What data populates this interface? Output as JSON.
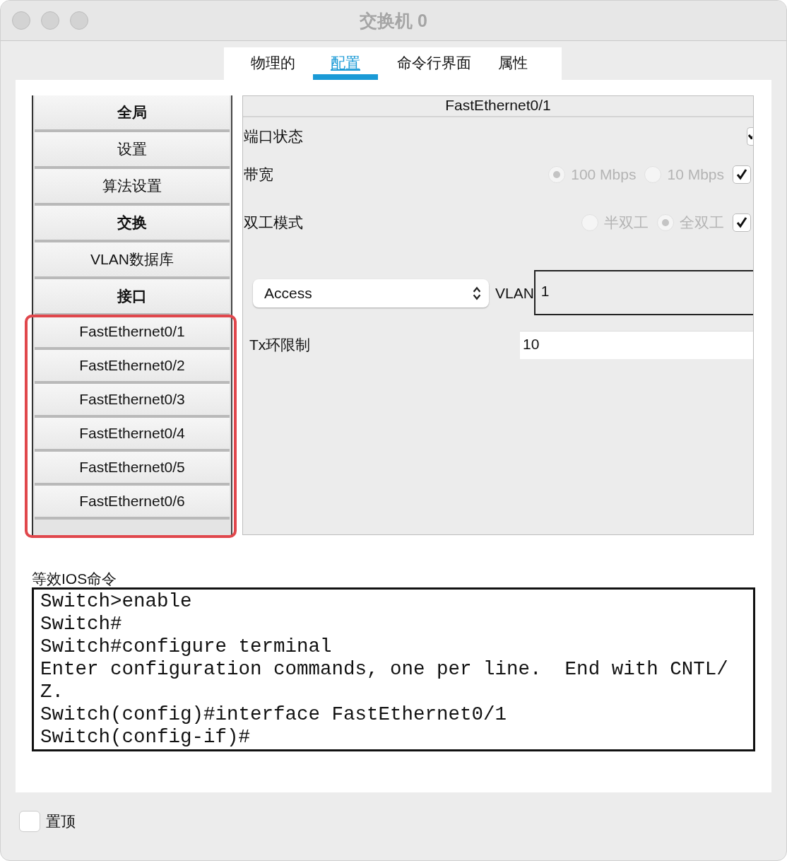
{
  "window": {
    "title": "交换机 0"
  },
  "tabs": [
    {
      "label": "物理的",
      "selected": false
    },
    {
      "label": "配置",
      "selected": true
    },
    {
      "label": "命令行界面",
      "selected": false
    },
    {
      "label": "属性",
      "selected": false
    }
  ],
  "sidebar": {
    "items": [
      {
        "label": "全局",
        "kind": "header"
      },
      {
        "label": "设置",
        "kind": "item"
      },
      {
        "label": "算法设置",
        "kind": "item"
      },
      {
        "label": "交换",
        "kind": "header"
      },
      {
        "label": "VLAN数据库",
        "kind": "item"
      },
      {
        "label": "接口",
        "kind": "header"
      }
    ],
    "interfaces": {
      "highlighted": true,
      "items": [
        {
          "label": "FastEthernet0/1",
          "selected": false
        },
        {
          "label": "FastEthernet0/2",
          "selected": false
        },
        {
          "label": "FastEthernet0/3",
          "selected": false
        },
        {
          "label": "FastEthernet0/4",
          "selected": false
        },
        {
          "label": "FastEthernet0/5",
          "selected": false
        },
        {
          "label": "FastEthernet0/6",
          "selected": false
        }
      ]
    }
  },
  "interface_panel": {
    "title": "FastEthernet0/1",
    "port_status": {
      "label": "端口状态",
      "checked": true
    },
    "bandwidth": {
      "label": "带宽",
      "disabled": true,
      "options": [
        {
          "label": "100 Mbps",
          "selected": true
        },
        {
          "label": "10 Mbps",
          "selected": false
        }
      ],
      "auto": {
        "checked": true
      }
    },
    "duplex": {
      "label": "双工模式",
      "disabled": true,
      "options": [
        {
          "label": "半双工",
          "selected": false
        },
        {
          "label": "全双工",
          "selected": true
        }
      ],
      "auto": {
        "checked": true
      }
    },
    "mode": {
      "value": "Access"
    },
    "vlan": {
      "label": "VLAN",
      "value": "1"
    },
    "tx_ring": {
      "label": "Tx环限制",
      "value": "10"
    }
  },
  "ios_commands": {
    "label": "等效IOS命令",
    "text": "Switch>enable\nSwitch#\nSwitch#configure terminal\nEnter configuration commands, one per line.  End with CNTL/Z.\nSwitch(config)#interface FastEthernet0/1\nSwitch(config-if)#"
  },
  "stay_on_top": {
    "label": "置顶",
    "checked": false
  }
}
